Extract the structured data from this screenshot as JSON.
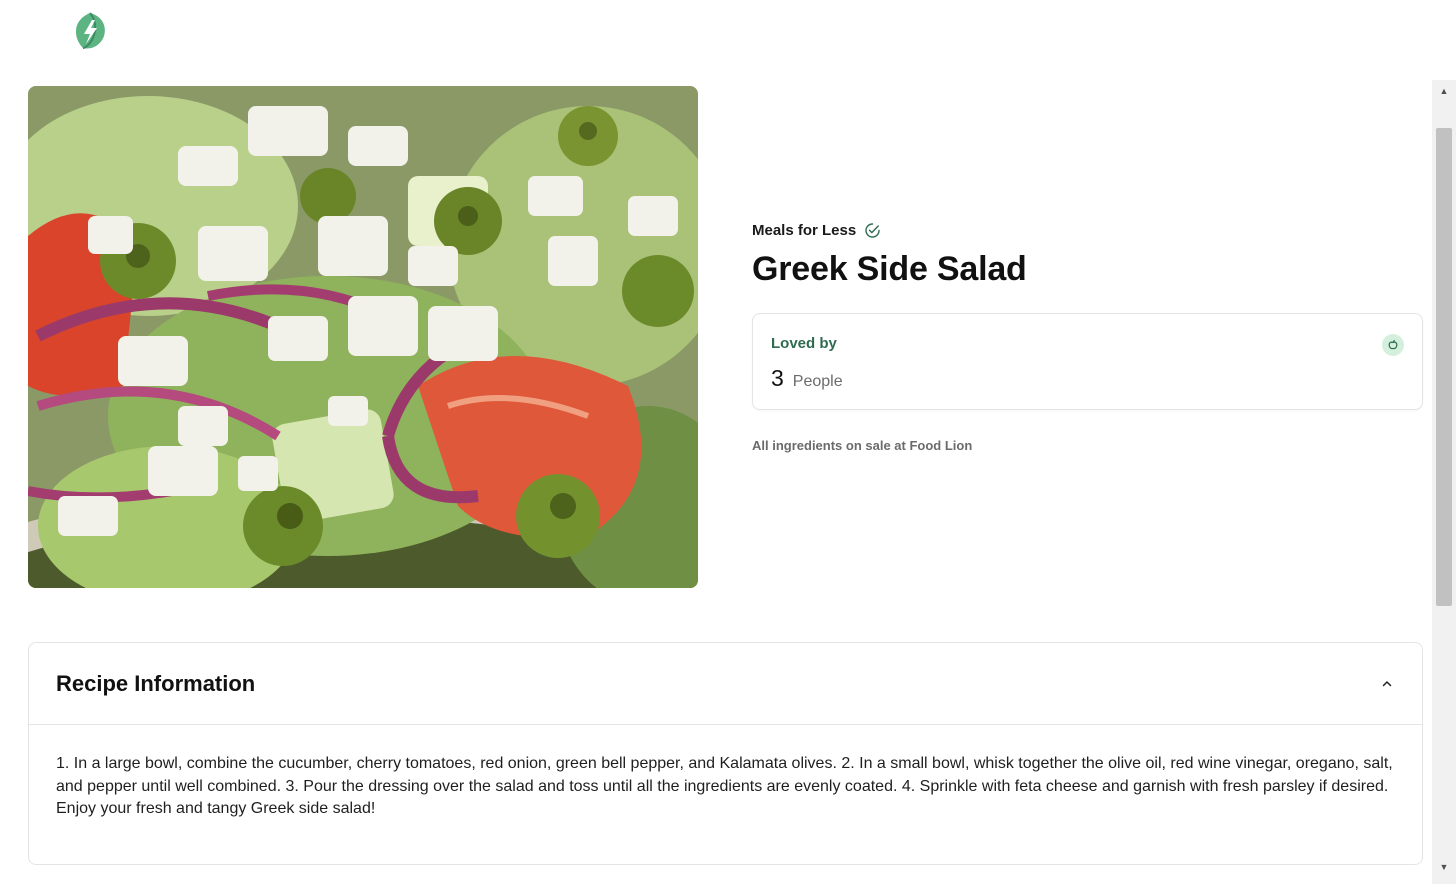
{
  "app": {
    "logo_icon": "leaf-bolt-logo",
    "accent_color": "#2f6b4f"
  },
  "recipe": {
    "brand": "Meals for Less",
    "brand_icon": "verified-check-icon",
    "title": "Greek Side Salad",
    "image_subject": "greek-salad-photo"
  },
  "loved": {
    "label": "Loved by",
    "count": "3",
    "unit": "People",
    "icon": "apple-icon"
  },
  "sale_note": "All ingredients on sale at Food Lion",
  "recipe_info": {
    "header": "Recipe Information",
    "toggle_icon": "chevron-up-icon",
    "instructions": "1. In a large bowl, combine the cucumber, cherry tomatoes, red onion, green bell pepper, and Kalamata olives. 2. In a small bowl, whisk together the olive oil, red wine vinegar, oregano, salt, and pepper until well combined. 3. Pour the dressing over the salad and toss until all the ingredients are evenly coated. 4. Sprinkle with feta cheese and garnish with fresh parsley if desired. Enjoy your fresh and tangy Greek side salad!"
  }
}
